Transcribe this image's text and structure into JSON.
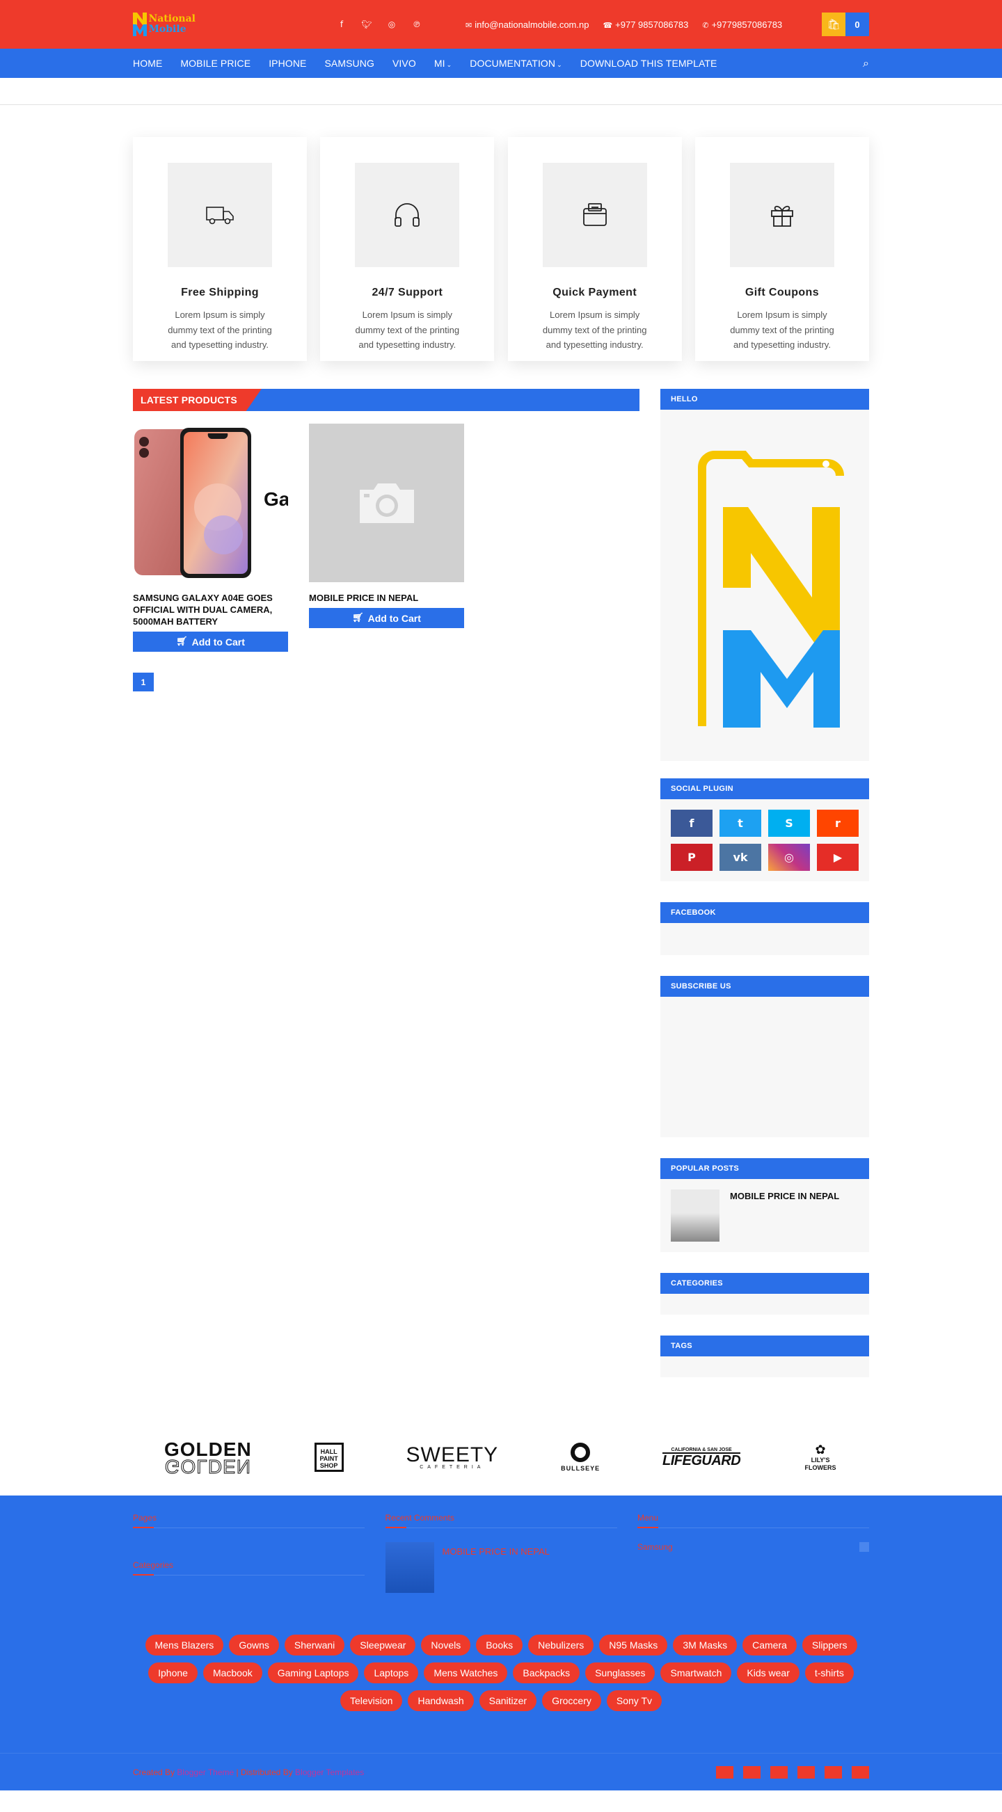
{
  "header": {
    "logo": {
      "line1": "National",
      "line2": "Mobile"
    },
    "social_icons": [
      "facebook-icon",
      "twitter-icon",
      "instagram-icon",
      "pinterest-icon"
    ],
    "email": "info@nationalmobile.com.np",
    "phone": "+977 9857086783",
    "whatsapp": "+9779857086783",
    "cart_count": "0"
  },
  "nav": {
    "items": [
      {
        "label": "HOME"
      },
      {
        "label": "MOBILE PRICE"
      },
      {
        "label": "IPHONE"
      },
      {
        "label": "SAMSUNG"
      },
      {
        "label": "VIVO"
      },
      {
        "label": "MI",
        "dropdown": true
      },
      {
        "label": "DOCUMENTATION",
        "dropdown": true
      },
      {
        "label": "DOWNLOAD THIS TEMPLATE"
      }
    ]
  },
  "features": [
    {
      "title": "Free Shipping",
      "text": "Lorem Ipsum is simply dummy text of the printing and typesetting industry.",
      "icon": "truck-icon"
    },
    {
      "title": "24/7 Support",
      "text": "Lorem Ipsum is simply dummy text of the printing and typesetting industry.",
      "icon": "headphones-icon"
    },
    {
      "title": "Quick Payment",
      "text": "Lorem Ipsum is simply dummy text of the printing and typesetting industry.",
      "icon": "wallet-icon"
    },
    {
      "title": "Gift Coupons",
      "text": "Lorem Ipsum is simply dummy text of the printing and typesetting industry.",
      "icon": "gift-icon"
    }
  ],
  "latest": {
    "heading": "LATEST PRODUCTS",
    "products": [
      {
        "title": "SAMSUNG GALAXY A04E GOES OFFICIAL WITH DUAL CAMERA, 5000MAH BATTERY",
        "button": "Add to Cart"
      },
      {
        "title": "MOBILE PRICE IN NEPAL",
        "button": "Add to Cart"
      }
    ],
    "page": "1"
  },
  "sidebar": {
    "hello": "HELLO",
    "social_plugin": "SOCIAL PLUGIN",
    "social_buttons": [
      {
        "name": "facebook",
        "glyph": "f",
        "color": "#3b5998"
      },
      {
        "name": "twitter",
        "glyph": "t",
        "color": "#1da1f2"
      },
      {
        "name": "skype",
        "glyph": "S",
        "color": "#00aff0"
      },
      {
        "name": "reddit",
        "glyph": "r",
        "color": "#ff4500"
      },
      {
        "name": "pinterest",
        "glyph": "P",
        "color": "#cb2027"
      },
      {
        "name": "vk",
        "glyph": "vk",
        "color": "#4c75a3"
      },
      {
        "name": "instagram",
        "glyph": "◎",
        "color": "#c13584"
      },
      {
        "name": "youtube",
        "glyph": "▶",
        "color": "#e52d27"
      }
    ],
    "facebook": "FACEBOOK",
    "subscribe": "SUBSCRIBE US",
    "popular": "POPULAR POSTS",
    "popular_post": "MOBILE PRICE IN NEPAL",
    "categories": "CATEGORIES",
    "tags": "TAGS"
  },
  "brands": [
    {
      "name": "GOLDEN"
    },
    {
      "name": "HALL PAINT SHOP"
    },
    {
      "name": "SWEETY",
      "sub": "CAFETERIA"
    },
    {
      "name": "BULLSEYE"
    },
    {
      "name": "LIFEGUARD",
      "sub": "CALIFORNIA & SAN JOSE"
    },
    {
      "name": "LILY'S FLOWERS"
    }
  ],
  "footer": {
    "col1_title": "Pages",
    "col1_title2": "Categories",
    "col2_title": "Recent Comments",
    "col2_post": "MOBILE PRICE IN NEPAL",
    "col3_title": "Menu",
    "col3_item": "Samsung",
    "tags": [
      "Mens Blazers",
      "Gowns",
      "Sherwani",
      "Sleepwear",
      "Novels",
      "Books",
      "Nebulizers",
      "N95 Masks",
      "3M Masks",
      "Camera",
      "Slippers",
      "Iphone",
      "Macbook",
      "Gaming Laptops",
      "Laptops",
      "Mens Watches",
      "Backpacks",
      "Sunglasses",
      "Smartwatch",
      "Kids wear",
      "t-shirts",
      "Television",
      "Handwash",
      "Sanitizer",
      "Groccery",
      "Sony Tv"
    ],
    "copyright_a": "Created By",
    "copyright_b": "Blogger Theme",
    "copyright_c": "| Distributed By",
    "copyright_d": "Blogger Templates"
  },
  "colors": {
    "red": "#ee3a2b",
    "blue": "#2a6fe8",
    "yellow": "#f9b71a"
  }
}
